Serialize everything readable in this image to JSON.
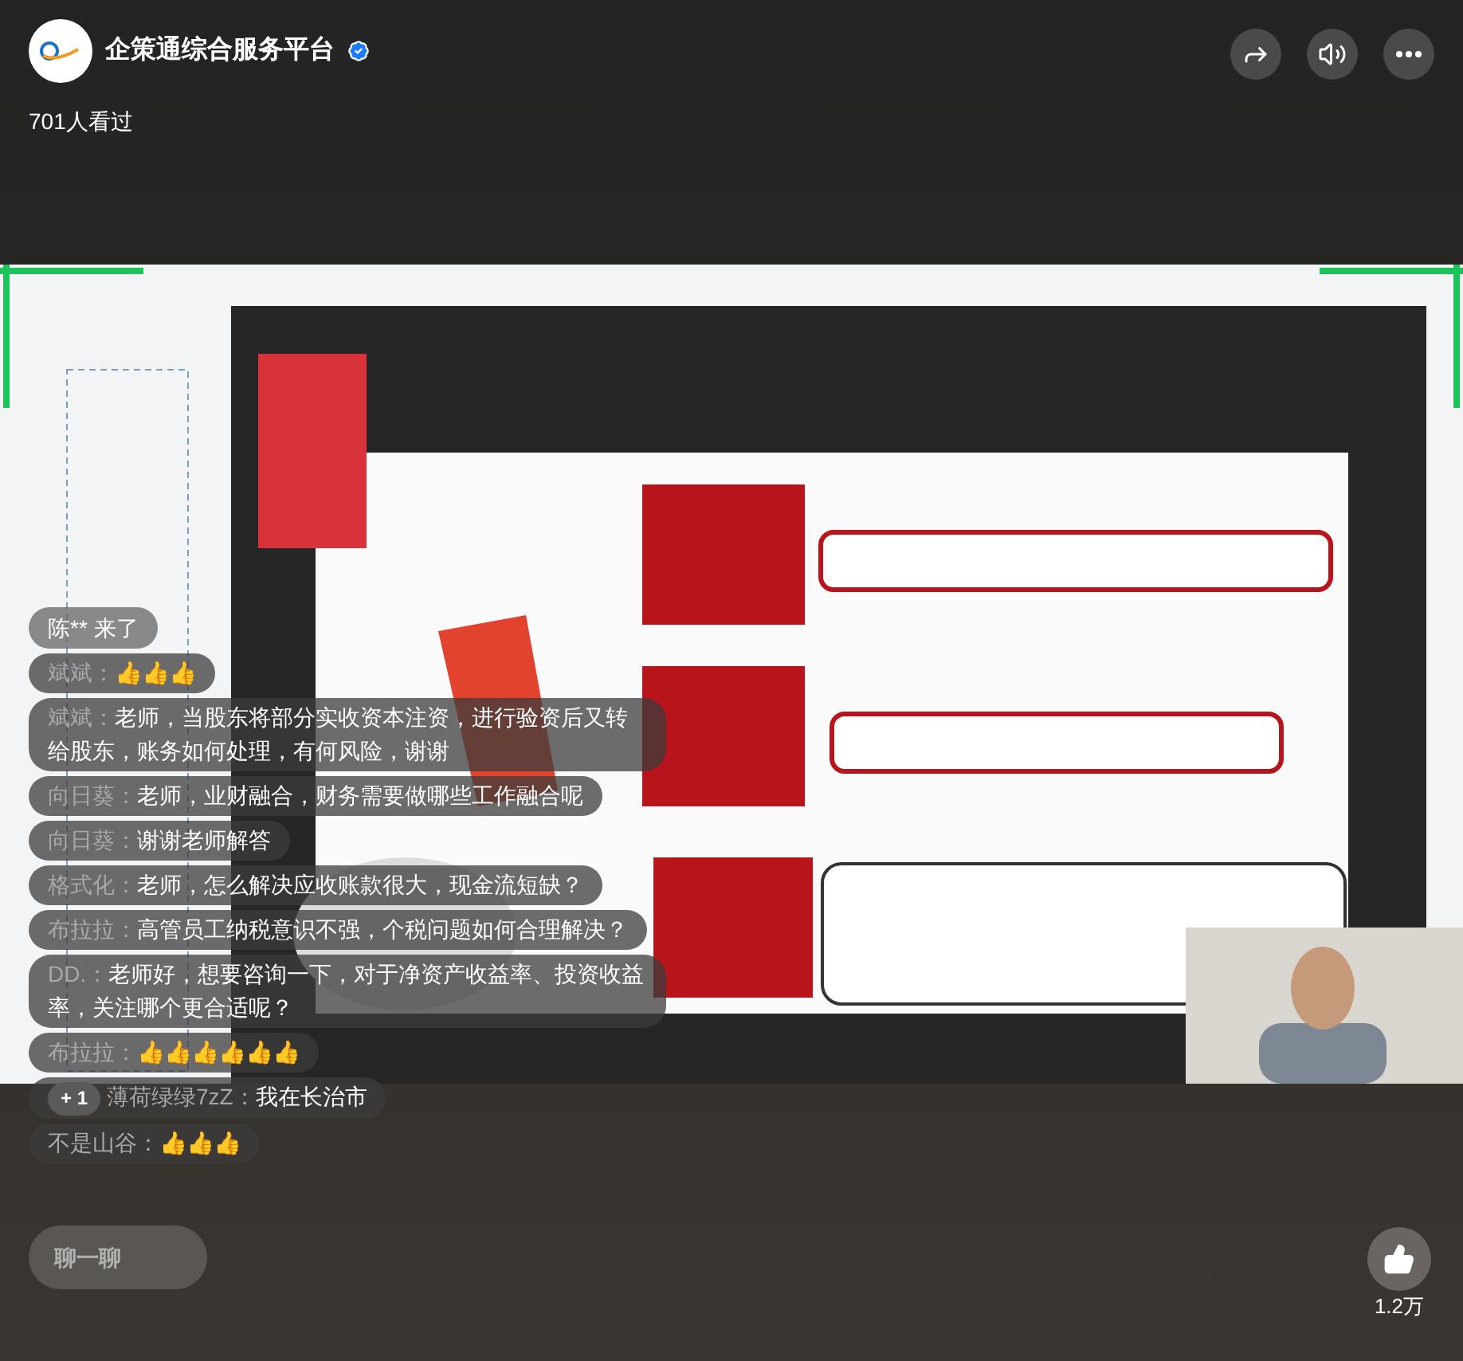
{
  "header": {
    "channel_name": "企策通综合服务平台",
    "verified": true,
    "views": "701人看过"
  },
  "comments": [
    {
      "kind": "join",
      "text": "陈** 来了"
    },
    {
      "kind": "message",
      "author": "斌斌：",
      "text": "👍👍👍"
    },
    {
      "kind": "message",
      "author": "斌斌：",
      "text": "老师，当股东将部分实收资本注资，进行验资后又转给股东，账务如何处理，有何风险，谢谢"
    },
    {
      "kind": "message",
      "author": "向日葵：",
      "text": "老师，业财融合，财务需要做哪些工作融合呢"
    },
    {
      "kind": "message",
      "author": "向日葵：",
      "text": "谢谢老师解答"
    },
    {
      "kind": "message",
      "author": "格式化：",
      "text": "老师，怎么解决应收账款很大，现金流短缺？"
    },
    {
      "kind": "message",
      "author": "布拉拉：",
      "text": "高管员工纳税意识不强，个税问题如何合理解决？"
    },
    {
      "kind": "message",
      "author": "DD.：",
      "text": "老师好，想要咨询一下，对于净资产收益率、投资收益率，关注哪个更合适呢？"
    },
    {
      "kind": "message",
      "author": "布拉拉：",
      "text": "👍👍👍👍👍👍"
    },
    {
      "kind": "message",
      "badge": "+ 1",
      "author": "薄荷绿绿7zZ：",
      "text": "我在长治市"
    },
    {
      "kind": "message",
      "author": "不是山谷：",
      "text": "👍👍👍"
    }
  ],
  "chat_input": {
    "placeholder": "聊一聊"
  },
  "likes": {
    "count": "1.2万"
  }
}
